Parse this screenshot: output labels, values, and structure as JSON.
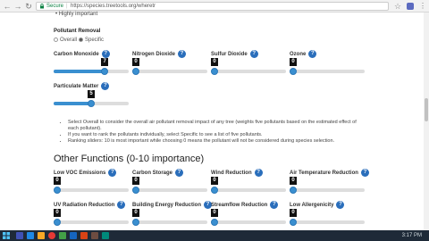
{
  "browser": {
    "secure_label": "Secure",
    "url": "https://species.treetools.org/wheretr",
    "back_icon": "back-arrow-icon",
    "forward_icon": "forward-arrow-icon",
    "reload_icon": "reload-icon"
  },
  "page": {
    "cutoff_text": "Highly important",
    "pollutant_heading": "Pollutant Removal",
    "radio_overall": "Overall",
    "radio_specific": "Specific",
    "selected_mode": "Specific",
    "pollutant_sliders": [
      {
        "label": "Carbon Monoxide",
        "value": "7",
        "fraction": 0.7
      },
      {
        "label": "Nitrogen Dioxide",
        "value": "0",
        "fraction": 0.0
      },
      {
        "label": "Sulfur Dioxide",
        "value": "0",
        "fraction": 0.0
      },
      {
        "label": "Ozone",
        "value": "0",
        "fraction": 0.0
      },
      {
        "label": "Particulate Matter",
        "value": "5",
        "fraction": 0.5
      }
    ],
    "bullets": [
      "Select Overall to consider the overall air pollutant removal impact of any tree (weights five pollutants based on the estimated effect of each pollutant).",
      "If you want to rank the pollutants individually, select Specific to see a list of five pollutants.",
      "Ranking sliders: 10 is most important while choosing 0 means the pollutant will not be considered during species selection."
    ],
    "other_heading": "Other Functions (0-10 importance)",
    "other_sliders": [
      {
        "label": "Low VOC Emissions",
        "value": "0",
        "fraction": 0.0
      },
      {
        "label": "Carbon Storage",
        "value": "0",
        "fraction": 0.0
      },
      {
        "label": "Wind Reduction",
        "value": "0",
        "fraction": 0.0
      },
      {
        "label": "Air Temperature Reduction",
        "value": "0",
        "fraction": 0.0
      },
      {
        "label": "UV Radiation Reduction",
        "value": "0",
        "fraction": 0.0
      },
      {
        "label": "Building Energy Reduction",
        "value": "0",
        "fraction": 0.0
      },
      {
        "label": "Streamflow Reduction",
        "value": "0",
        "fraction": 0.0
      },
      {
        "label": "Low Allergenicity",
        "value": "0",
        "fraction": 0.0
      }
    ],
    "help_glyph": "?"
  },
  "taskbar": {
    "clock": "3:17 PM"
  },
  "colors": {
    "accent": "#3a8fd0",
    "help_badge": "#2a6ebb",
    "value_badge": "#111111",
    "taskbar": "#1e2a38"
  }
}
